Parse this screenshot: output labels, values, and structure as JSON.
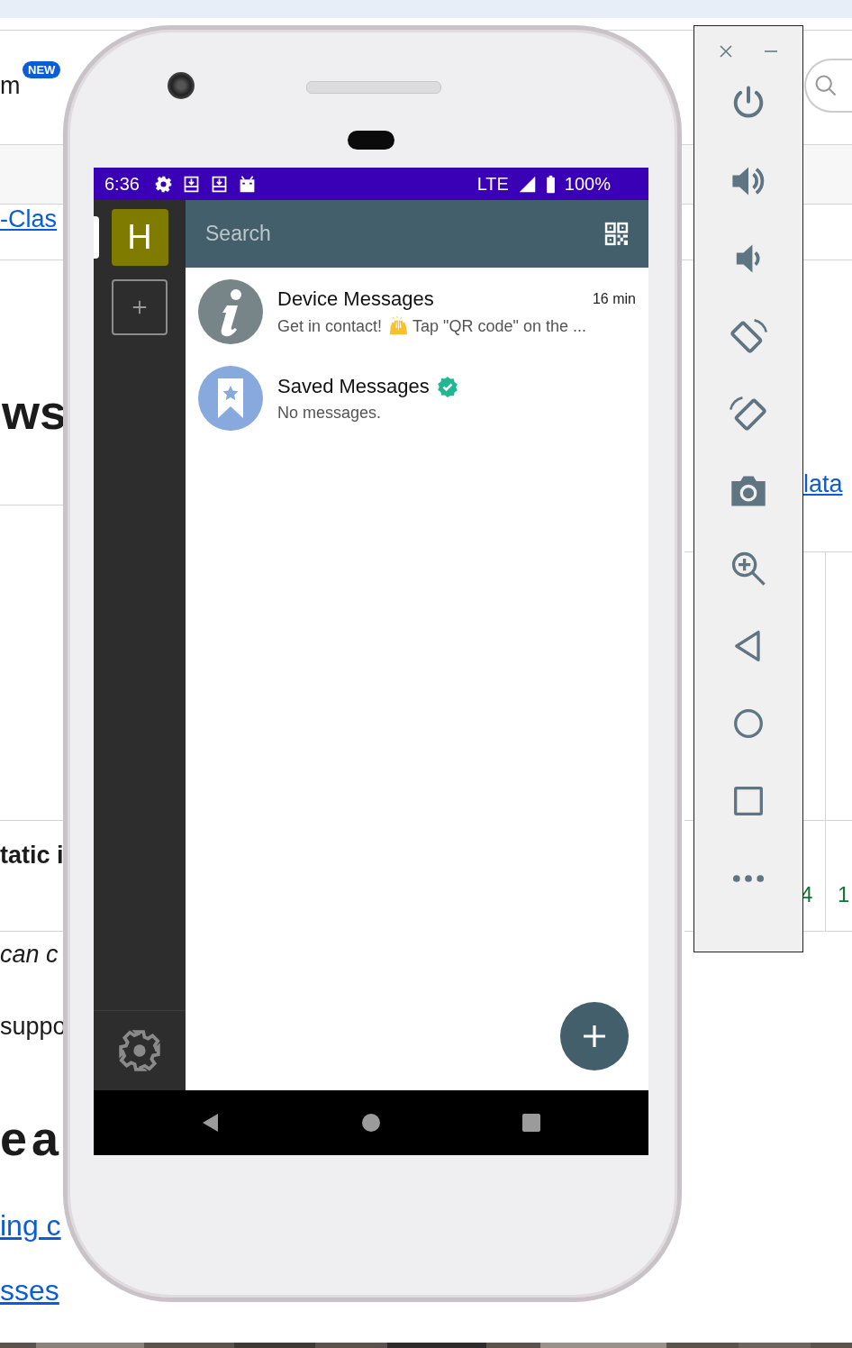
{
  "web_page": {
    "badge": "NEW",
    "fragments": [
      {
        "kind": "body",
        "text": "m"
      },
      {
        "kind": "link",
        "text": "-Clas"
      },
      {
        "kind": "heading",
        "text": "ws"
      },
      {
        "kind": "strong",
        "text": "tatic i"
      },
      {
        "kind": "italic",
        "text": "can c"
      },
      {
        "kind": "body",
        "text": "suppo"
      },
      {
        "kind": "heading",
        "text": "e a"
      },
      {
        "kind": "biglink",
        "text": "ing c"
      },
      {
        "kind": "biglink",
        "text": "sses"
      },
      {
        "kind": "link",
        "text": "lata"
      },
      {
        "kind": "number",
        "text": "4"
      },
      {
        "kind": "number",
        "text": "1"
      }
    ]
  },
  "status_bar": {
    "time": "6:36",
    "network": "LTE",
    "battery": "100%"
  },
  "accounts": [
    {
      "initial": "H",
      "color": "#7f7a00",
      "selected": true
    }
  ],
  "search": {
    "placeholder": "Search"
  },
  "chats": [
    {
      "title": "Device Messages",
      "kind": "info",
      "verified": false,
      "time": "16 min",
      "preview": [
        {
          "kind": "text",
          "text": "Get in contact!"
        },
        {
          "kind": "emoji"
        },
        {
          "kind": "text",
          "text": "Tap \"QR code\" on the ..."
        }
      ]
    },
    {
      "title": "Saved Messages",
      "kind": "saved",
      "verified": true,
      "preview": [
        {
          "kind": "text",
          "text": "No messages."
        }
      ]
    }
  ]
}
